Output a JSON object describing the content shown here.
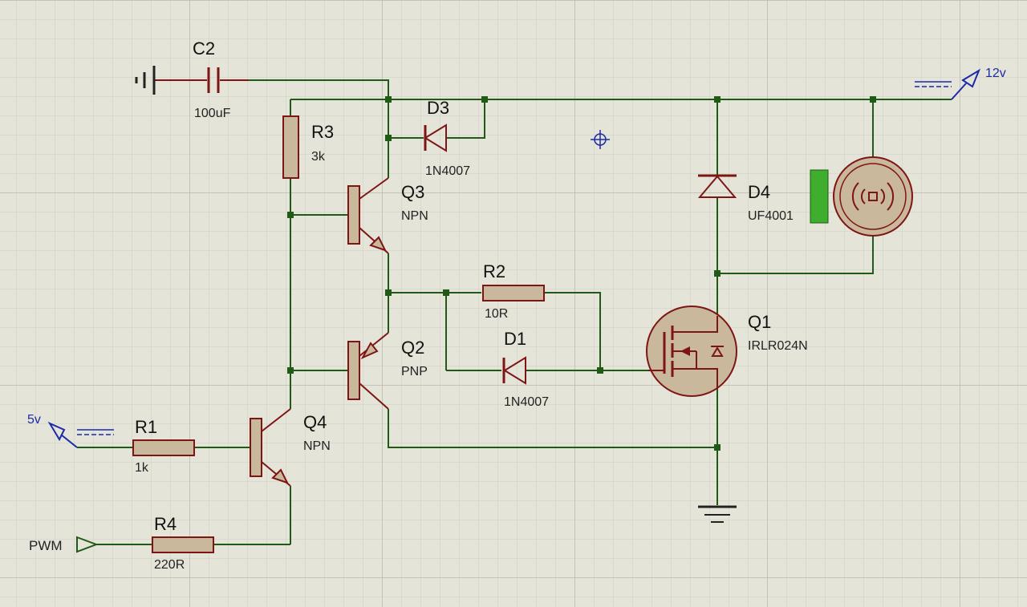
{
  "components": {
    "c2": {
      "name": "C2",
      "value": "100uF"
    },
    "r3": {
      "name": "R3",
      "value": "3k"
    },
    "d3": {
      "name": "D3",
      "value": "1N4007"
    },
    "q3": {
      "name": "Q3",
      "value": "NPN"
    },
    "r2": {
      "name": "R2",
      "value": "10R"
    },
    "d1": {
      "name": "D1",
      "value": "1N4007"
    },
    "q2": {
      "name": "Q2",
      "value": "PNP"
    },
    "q4": {
      "name": "Q4",
      "value": "NPN"
    },
    "r1": {
      "name": "R1",
      "value": "1k"
    },
    "r4": {
      "name": "R4",
      "value": "220R"
    },
    "d4": {
      "name": "D4",
      "value": "UF4001"
    },
    "q1": {
      "name": "Q1",
      "value": "IRLR024N"
    }
  },
  "terminals": {
    "vcc12": "12v",
    "vcc5": "5v",
    "pwm": "PWM"
  },
  "colors": {
    "background": "#e5e4d8",
    "grid_minor": "#cfcec2",
    "grid_major": "#b9b8ab",
    "wire": "#1f5b16",
    "component": "#7d1515",
    "component_fill": "#c9b89c",
    "terminal": "#1b2aa8",
    "motor_indicator": "#3fae2f"
  },
  "icons": [
    "ground-icon",
    "power-terminal-icon",
    "input-terminal-icon",
    "cursor-crosshair-icon",
    "dc-motor-icon"
  ]
}
